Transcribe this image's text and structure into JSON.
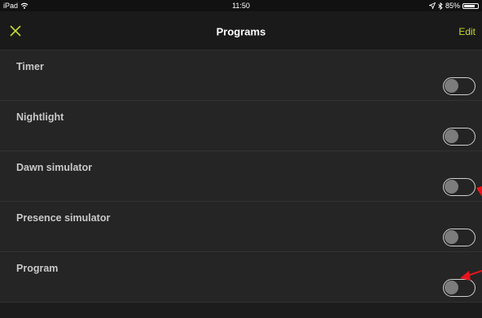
{
  "status_bar": {
    "device": "iPad",
    "time": "11:50",
    "battery": "85%",
    "battery_level": 0.85
  },
  "nav": {
    "title": "Programs",
    "edit_label": "Edit",
    "close_icon": "close-icon"
  },
  "programs": [
    {
      "label": "Timer",
      "enabled": false
    },
    {
      "label": "Nightlight",
      "enabled": false
    },
    {
      "label": "Dawn simulator",
      "enabled": false
    },
    {
      "label": "Presence simulator",
      "enabled": false
    },
    {
      "label": "Program",
      "enabled": false
    }
  ],
  "colors": {
    "accent": "#c5d82b",
    "background": "#252525",
    "annotation_arrow": "#e8141c"
  }
}
